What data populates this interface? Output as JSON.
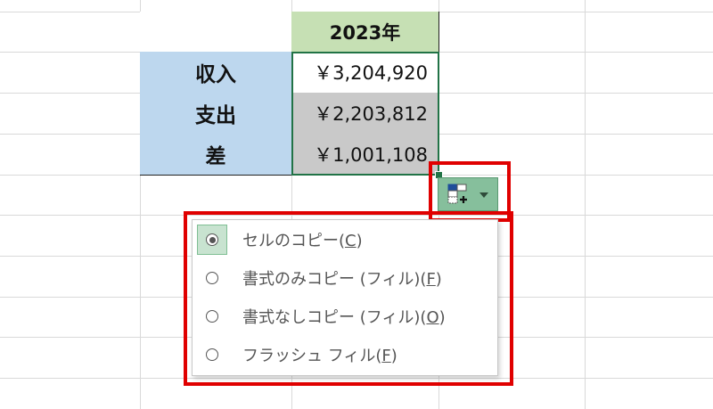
{
  "table": {
    "header_year": "2023年",
    "rows": [
      {
        "label": "収入",
        "value": "￥3,204,920"
      },
      {
        "label": "支出",
        "value": "￥2,203,812"
      },
      {
        "label": "差",
        "value": "￥1,001,108"
      }
    ]
  },
  "autofill_button": {
    "icon": "autofill-options-icon",
    "caret_icon": "chevron-down-icon"
  },
  "menu": {
    "items": [
      {
        "text": "セルのコピー(",
        "key": "C",
        "close": ")",
        "selected": true
      },
      {
        "text": "書式のみコピー (フィル)(",
        "key": "F",
        "close": ")",
        "selected": false
      },
      {
        "text": "書式なしコピー (フィル)(",
        "key": "O",
        "close": ")",
        "selected": false
      },
      {
        "text": "フラッシュ フィル(",
        "key": "F",
        "close": ")",
        "selected": false
      }
    ]
  },
  "colors": {
    "label_fill": "#bdd7ee",
    "year_fill": "#c6e0b4",
    "selected_fill": "#c9c9c9",
    "selection_border": "#217346",
    "highlight": "#e00000"
  }
}
